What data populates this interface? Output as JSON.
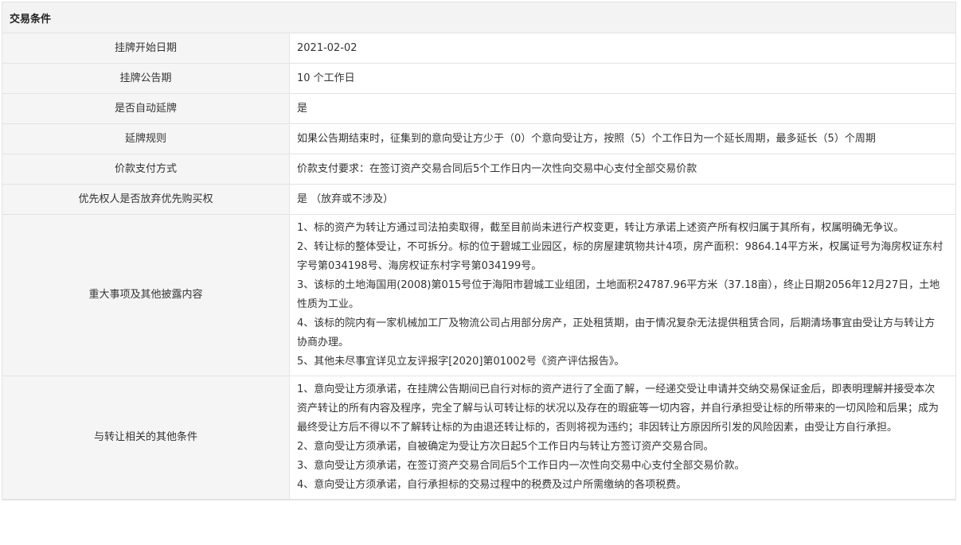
{
  "section": {
    "title": "交易条件"
  },
  "rows": [
    {
      "label": "挂牌开始日期",
      "value": "2021-02-02"
    },
    {
      "label": "挂牌公告期",
      "value": "10 个工作日"
    },
    {
      "label": "是否自动延牌",
      "value": "是"
    },
    {
      "label": "延牌规则",
      "value": "如果公告期结束时，征集到的意向受让方少于（0）个意向受让方，按照（5）个工作日为一个延长周期，最多延长（5）个周期"
    },
    {
      "label": "价款支付方式",
      "value": "价款支付要求：在签订资产交易合同后5个工作日内一次性向交易中心支付全部交易价款"
    },
    {
      "label": "优先权人是否放弃优先购买权",
      "value": "是 （放弃或不涉及）"
    }
  ],
  "major_items": {
    "label": "重大事项及其他披露内容",
    "lines": [
      "1、标的资产为转让方通过司法拍卖取得，截至目前尚未进行产权变更，转让方承诺上述资产所有权归属于其所有，权属明确无争议。",
      "2、转让标的整体受让，不可拆分。标的位于碧城工业园区，标的房屋建筑物共计4项，房产面积：9864.14平方米，权属证号为海房权证东村字号第034198号、海房权证东村字号第034199号。",
      "3、该标的土地海国用(2008)第015号位于海阳市碧城工业组团，土地面积24787.96平方米（37.18亩），终止日期2056年12月27日，土地性质为工业。",
      "4、该标的院内有一家机械加工厂及物流公司占用部分房产，正处租赁期，由于情况复杂无法提供租赁合同，后期清场事宜由受让方与转让方协商办理。",
      "5、其他未尽事宜详见立友评报字[2020]第01002号《资产评估报告》。"
    ]
  },
  "other_conditions": {
    "label": "与转让相关的其他条件",
    "lines": [
      "1、意向受让方须承诺，在挂牌公告期间已自行对标的资产进行了全面了解，一经递交受让申请并交纳交易保证金后，即表明理解并接受本次资产转让的所有内容及程序，完全了解与认可转让标的状况以及存在的瑕疵等一切内容，并自行承担受让标的所带来的一切风险和后果；成为最终受让方后不得以不了解转让标的为由退还转让标的，否则将视为违约；非因转让方原因所引发的风险因素，由受让方自行承担。",
      "2、意向受让方须承诺，自被确定为受让方次日起5个工作日内与转让方签订资产交易合同。",
      "3、意向受让方须承诺，在签订资产交易合同后5个工作日内一次性向交易中心支付全部交易价款。",
      "4、意向受让方须承诺，自行承担标的交易过程中的税费及过户所需缴纳的各项税费。"
    ]
  }
}
